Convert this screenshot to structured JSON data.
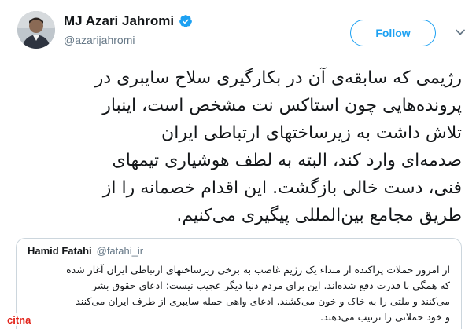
{
  "author": {
    "display_name": "MJ Azari Jahromi",
    "handle": "@azarijahromi",
    "verified": true,
    "icon": "verified-badge-icon"
  },
  "follow_button": {
    "label": "Follow"
  },
  "menu": {
    "icon": "chevron-down-icon"
  },
  "tweet": {
    "lines": [
      "رژیمی که سابقه‌ی آن در بکارگیری سلاح سایبری در",
      "پرونده‌هایی چون استاکس نت مشخص است، اینبار",
      "تلاش داشت به زیرساختهای ارتباطی ایران",
      "صدمه‌ای وارد کند، البته به لطف هوشیاری تیمهای",
      "فنی، دست خالی بازگشت. این اقدام خصمانه را از",
      "طریق مجامع بین‌المللی پیگیری می‌کنیم."
    ]
  },
  "quoted_tweet": {
    "display_name": "Hamid Fatahi",
    "handle": "@fatahi_ir",
    "lines": [
      "از امروز حملات پراکنده از مبداء یک رژیم غاصب به برخی زیرساختهای ارتباطی ایران آغاز شده",
      "که همگی با قدرت دفع شده‌اند. این برای مردم دنیا دیگر عجیب نیست: ادعای حقوق بشر",
      "می‌کنند و ملتی را به خاک و خون می‌کشند. ادعای واهی حمله سایبری از طرف ایران می‌کنند",
      "و خود حملاتی را ترتیب می‌دهند."
    ]
  },
  "watermark": {
    "text": "citna",
    "color": "#e2231a"
  },
  "colors": {
    "accent": "#1da1f2",
    "text": "#14171a",
    "muted": "#657786",
    "border": "#ccd6dd"
  }
}
